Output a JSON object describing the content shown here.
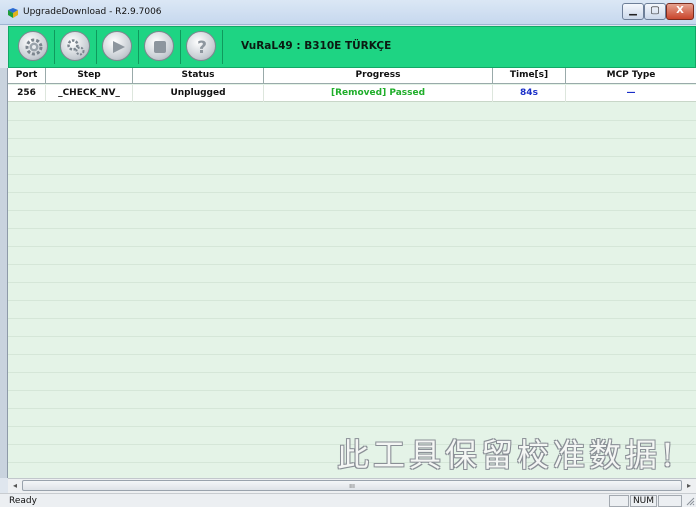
{
  "window": {
    "title": "UpgradeDownload - R2.9.7006",
    "min": "▁",
    "max": "▢",
    "close": "X"
  },
  "toolbar": {
    "banner": "VuRaL49 : B310E TÜRKÇE",
    "help_glyph": "?"
  },
  "columns": [
    "Port",
    "Step",
    "Status",
    "Progress",
    "Time[s]",
    "MCP Type"
  ],
  "rows": [
    {
      "port": "256",
      "step": "_CHECK_NV_",
      "status": "Unplugged",
      "progress": "[Removed] Passed",
      "time": "84s",
      "mcp": "—"
    }
  ],
  "watermark": "此工具保留校准数据!",
  "scrollbar": {
    "left": "◂",
    "right": "▸",
    "thumb": "ııı"
  },
  "statusbar": {
    "ready": "Ready",
    "num": "NUM",
    "pane3": ""
  },
  "colors": {
    "toolbar": "#1ed483",
    "progress_text": "#1fae2a",
    "time_text": "#1a2fc8",
    "grid_bg": "#e4f3e7"
  }
}
